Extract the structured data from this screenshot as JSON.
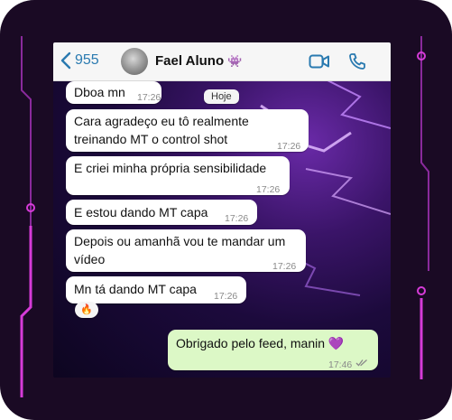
{
  "header": {
    "back_count": "955",
    "contact_name": "Fael Aluno",
    "contact_emoji": "👾"
  },
  "date_separator": "Hoje",
  "messages": [
    {
      "text": "Dboa mn",
      "time": "17:26"
    },
    {
      "text": "Cara agradeço eu tô realmente treinando MT o control shot",
      "time": "17:26"
    },
    {
      "text": "E criei minha própria sensibilidade",
      "time": "17:26"
    },
    {
      "text": "E estou dando MT capa",
      "time": "17:26"
    },
    {
      "text": "Depois ou amanhã vou te mandar um vídeo",
      "time": "17:26"
    },
    {
      "text": "Mn tá dando MT capa",
      "time": "17:26",
      "reaction": "🔥"
    },
    {
      "text": "Obrigado pelo feed, manin 💜",
      "time": "17:46",
      "outgoing": true
    }
  ],
  "colors": {
    "accent": "#2a7ab0",
    "outgoing_bubble": "#dcf8c6",
    "incoming_bubble": "#ffffff",
    "frame_glow": "#d63bd8"
  },
  "icons": [
    "chevron-left-icon",
    "video-call-icon",
    "phone-icon",
    "double-check-icon"
  ]
}
